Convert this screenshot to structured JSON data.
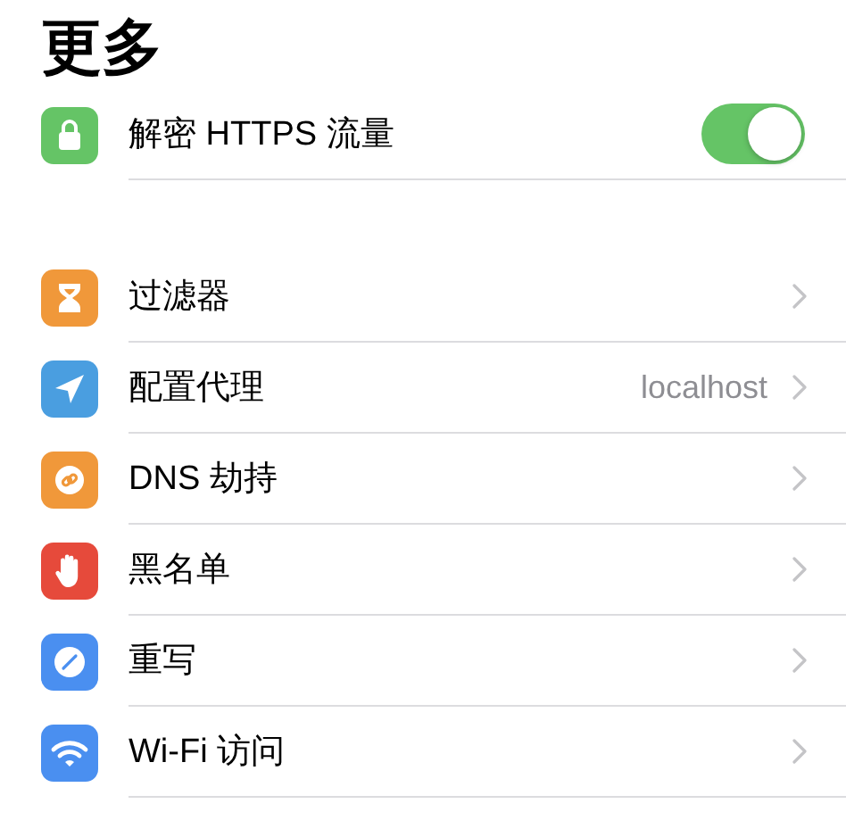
{
  "title": "更多",
  "toggle_row": {
    "label": "解密 HTTPS 流量",
    "on": true,
    "color": "#65c466"
  },
  "items": [
    {
      "label": "过滤器",
      "color": "#f0983a"
    },
    {
      "label": "配置代理",
      "color": "#4a9ee0",
      "value": "localhost"
    },
    {
      "label": "DNS 劫持",
      "color": "#f0983a"
    },
    {
      "label": "黑名单",
      "color": "#e64a3b"
    },
    {
      "label": "重写",
      "color": "#4a8ff0"
    },
    {
      "label": "Wi-Fi 访问",
      "color": "#4a8ff0"
    }
  ]
}
